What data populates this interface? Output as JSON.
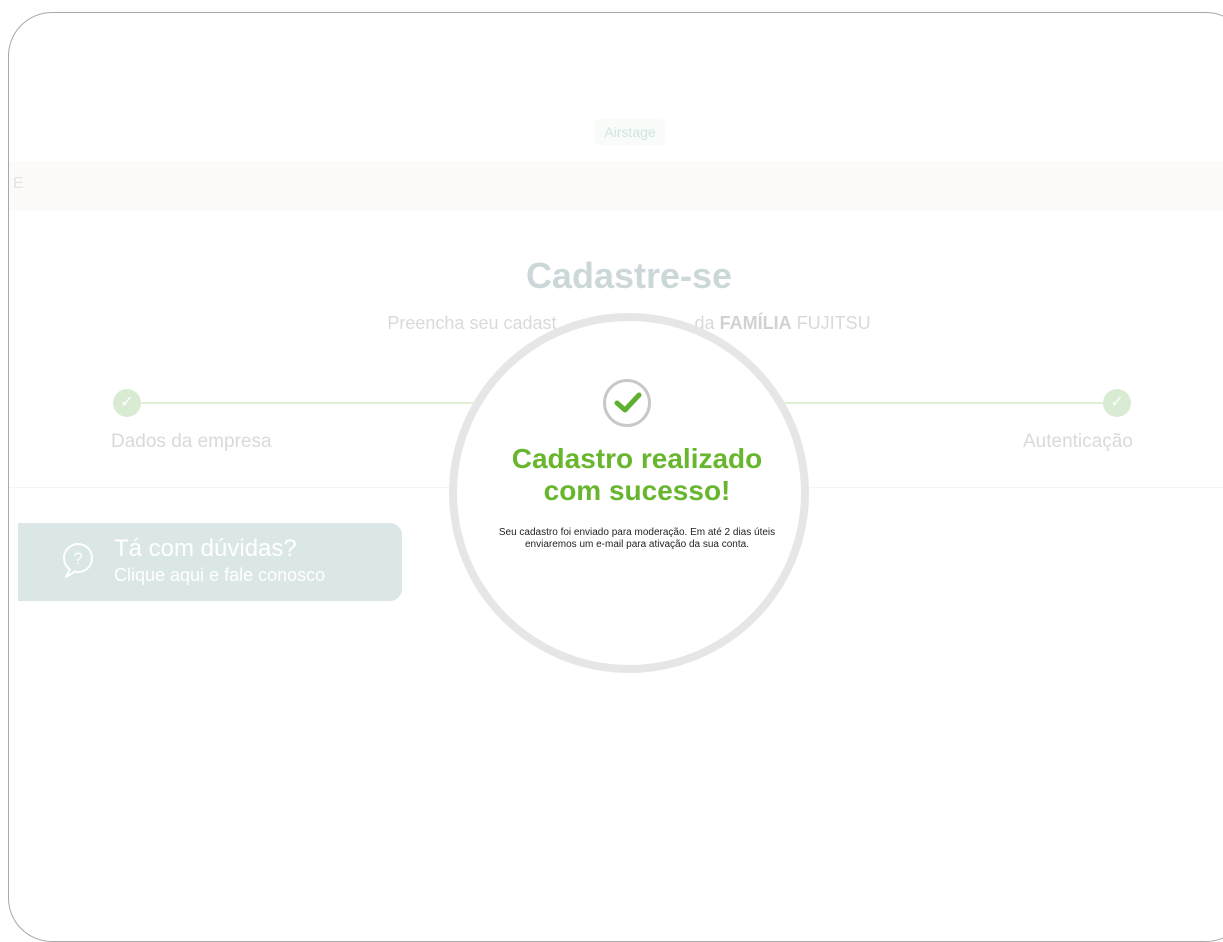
{
  "header": {
    "brand": "Airstage"
  },
  "nav": {
    "fragment": "E"
  },
  "registration": {
    "title": "Cadastre-se",
    "subtitle_start": "Preencha seu cadast",
    "subtitle_mid": "da",
    "subtitle_bold": "FAMÍLIA",
    "subtitle_end": "FUJITSU"
  },
  "steps": [
    {
      "label": "Dados da empresa",
      "status": "done"
    },
    {
      "label": "Autenticação",
      "status": "done"
    }
  ],
  "help": {
    "title": "Tá com dúvidas?",
    "subtitle": "Clique aqui e fale conosco",
    "icon": "question-bubble-icon"
  },
  "modal": {
    "icon": "check-icon",
    "title_line1": "Cadastro realizado",
    "title_line2": "com sucesso!",
    "message_line1": "Seu cadastro foi enviado para moderação. Em até 2 dias úteis",
    "message_line2": "enviaremos um e-mail para ativação da sua conta."
  },
  "colors": {
    "accent": "#68b62e",
    "step_done": "#56a83a",
    "help_box": "#dbe6e6",
    "ring": "#e6e6e6"
  }
}
